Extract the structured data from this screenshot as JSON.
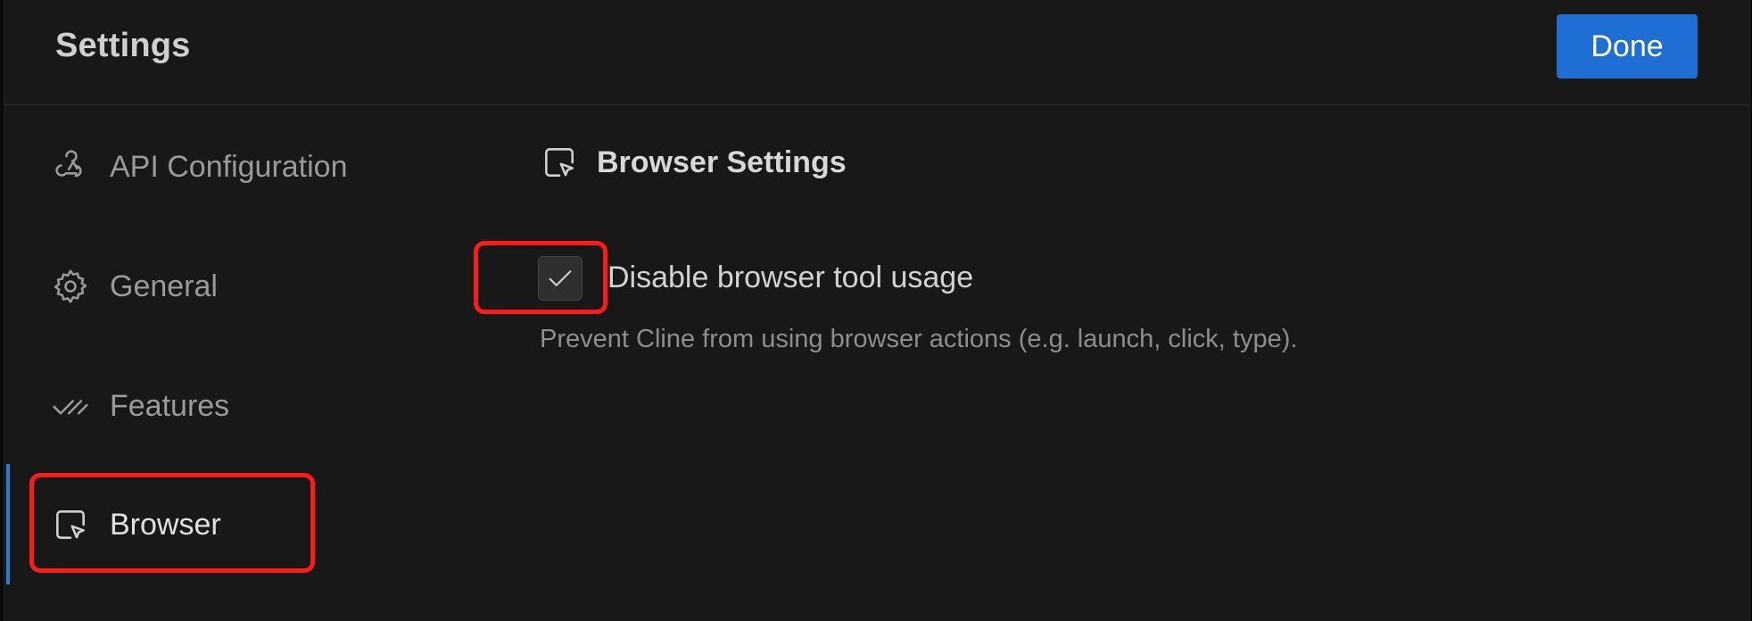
{
  "header": {
    "title": "Settings",
    "done_label": "Done"
  },
  "sidebar": {
    "items": [
      {
        "label": "API Configuration",
        "icon": "webhook-icon",
        "active": false
      },
      {
        "label": "General",
        "icon": "gear-icon",
        "active": false
      },
      {
        "label": "Features",
        "icon": "check-check-icon",
        "active": false
      },
      {
        "label": "Browser",
        "icon": "cursor-square-icon",
        "active": true
      }
    ]
  },
  "main": {
    "section_title": "Browser Settings",
    "section_icon": "cursor-square-icon",
    "option": {
      "label": "Disable browser tool usage",
      "checked": true,
      "description": "Prevent Cline from using browser actions (e.g. launch, click, type)."
    }
  },
  "colors": {
    "accent": "#1f6ed4",
    "highlight": "#ff1a1a",
    "background": "#181818"
  }
}
